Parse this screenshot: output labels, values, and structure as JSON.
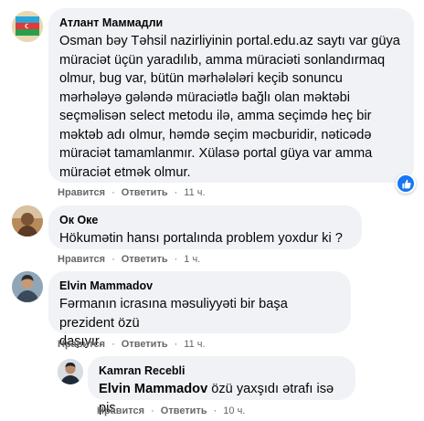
{
  "comments": [
    {
      "author": "Атлант Маммадли",
      "text": "Osman bəy Təhsil nazirliyinin portal.edu.az saytı var güya\nmüraciət üçün yaradılıb, amma müraciəti sonlandırmaq\nolmur, bug var, bütün mərhələləri keçib sonuncu\nmərhələyə gələndə müraciətlə bağlı olan məktəbi\nseçməlisən select metodu ilə, amma seçimdə heç bir\nməktəb adı olmur, həmdə seçim məcburidir, nəticədə\nmüraciət tamamlanmır. Xülasə portal güya var amma\nmüraciət etmək olmur.",
      "like_label": "Нравится",
      "reply_label": "Ответить",
      "time": "11 ч."
    },
    {
      "author": "Ок Оке",
      "text": "Hökumətin hansı portalında problem yoxdur ki ?",
      "like_label": "Нравится",
      "reply_label": "Ответить",
      "time": "1 ч."
    },
    {
      "author": "Elvin Mammadov",
      "text": "Fərmanın icrasına məsuliyyəti bir başa prezident özü\ndaşıyır.",
      "like_label": "Нравится",
      "reply_label": "Ответить",
      "time": "11 ч."
    },
    {
      "author": "Kamran Recebli",
      "mention": "Elvin Mammadov",
      "text": " özü yaxşıdı ətrafı isə pis",
      "like_label": "Нравится",
      "reply_label": "Ответить",
      "time": "10 ч."
    }
  ],
  "colors": {
    "bubble_bg": "#f0f2f5",
    "meta_text": "#65676b",
    "like_blue": "#1877f2"
  },
  "icons": [
    "flag-avatar",
    "person-avatar",
    "person-avatar",
    "person-avatar",
    "like-reaction-icon"
  ]
}
